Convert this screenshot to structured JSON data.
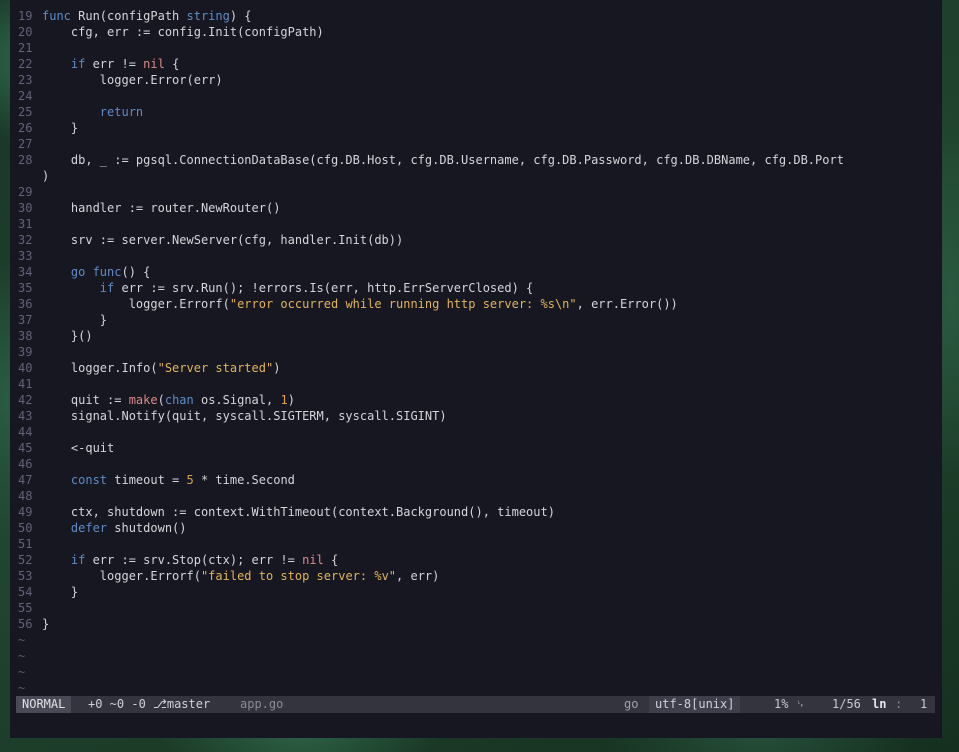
{
  "editor": {
    "lines": [
      {
        "n": "19",
        "segs": [
          [
            "kw",
            "func"
          ],
          [
            "t",
            " Run(configPath "
          ],
          [
            "kw",
            "string"
          ],
          [
            "t",
            ") {"
          ]
        ]
      },
      {
        "n": "20",
        "segs": [
          [
            "t",
            "    cfg, err := config.Init(configPath)"
          ]
        ]
      },
      {
        "n": "21",
        "segs": []
      },
      {
        "n": "22",
        "segs": [
          [
            "t",
            "    "
          ],
          [
            "kw",
            "if"
          ],
          [
            "t",
            " err != "
          ],
          [
            "bi",
            "nil"
          ],
          [
            "t",
            " {"
          ]
        ]
      },
      {
        "n": "23",
        "segs": [
          [
            "t",
            "        logger.Error(err)"
          ]
        ]
      },
      {
        "n": "24",
        "segs": []
      },
      {
        "n": "25",
        "segs": [
          [
            "t",
            "        "
          ],
          [
            "kw",
            "return"
          ]
        ]
      },
      {
        "n": "26",
        "segs": [
          [
            "t",
            "    }"
          ]
        ]
      },
      {
        "n": "27",
        "segs": []
      },
      {
        "n": "28",
        "segs": [
          [
            "t",
            "    db, _ := pgsql.ConnectionDataBase(cfg.DB.Host, cfg.DB.Username, cfg.DB.Password, cfg.DB.DBName, cfg.DB.Port"
          ]
        ]
      },
      {
        "n": "",
        "segs": [
          [
            "t",
            ")"
          ]
        ]
      },
      {
        "n": "29",
        "segs": []
      },
      {
        "n": "30",
        "segs": [
          [
            "t",
            "    handler := router.NewRouter()"
          ]
        ]
      },
      {
        "n": "31",
        "segs": []
      },
      {
        "n": "32",
        "segs": [
          [
            "t",
            "    srv := server.NewServer(cfg, handler.Init(db))"
          ]
        ]
      },
      {
        "n": "33",
        "segs": []
      },
      {
        "n": "34",
        "segs": [
          [
            "t",
            "    "
          ],
          [
            "kw",
            "go func"
          ],
          [
            "t",
            "() {"
          ]
        ]
      },
      {
        "n": "35",
        "segs": [
          [
            "t",
            "        "
          ],
          [
            "kw",
            "if"
          ],
          [
            "t",
            " err := srv.Run(); !errors.Is(err, http.ErrServerClosed) {"
          ]
        ]
      },
      {
        "n": "36",
        "segs": [
          [
            "t",
            "            logger.Errorf("
          ],
          [
            "str",
            "\"error occurred while running http server: %s\\n\""
          ],
          [
            "t",
            ", err.Error())"
          ]
        ]
      },
      {
        "n": "37",
        "segs": [
          [
            "t",
            "        }"
          ]
        ]
      },
      {
        "n": "38",
        "segs": [
          [
            "t",
            "    }()"
          ]
        ]
      },
      {
        "n": "39",
        "segs": []
      },
      {
        "n": "40",
        "segs": [
          [
            "t",
            "    logger.Info("
          ],
          [
            "str",
            "\"Server started\""
          ],
          [
            "t",
            ")"
          ]
        ]
      },
      {
        "n": "41",
        "segs": []
      },
      {
        "n": "42",
        "segs": [
          [
            "t",
            "    quit := "
          ],
          [
            "bi",
            "make"
          ],
          [
            "t",
            "("
          ],
          [
            "kw",
            "chan"
          ],
          [
            "t",
            " os.Signal, "
          ],
          [
            "num",
            "1"
          ],
          [
            "t",
            ")"
          ]
        ]
      },
      {
        "n": "43",
        "segs": [
          [
            "t",
            "    signal.Notify(quit, syscall.SIGTERM, syscall.SIGINT)"
          ]
        ]
      },
      {
        "n": "44",
        "segs": []
      },
      {
        "n": "45",
        "segs": [
          [
            "t",
            "    <-quit"
          ]
        ]
      },
      {
        "n": "46",
        "segs": []
      },
      {
        "n": "47",
        "segs": [
          [
            "t",
            "    "
          ],
          [
            "kw",
            "const"
          ],
          [
            "t",
            " timeout = "
          ],
          [
            "num",
            "5"
          ],
          [
            "t",
            " * time.Second"
          ]
        ]
      },
      {
        "n": "48",
        "segs": []
      },
      {
        "n": "49",
        "segs": [
          [
            "t",
            "    ctx, shutdown := context.WithTimeout(context.Background(), timeout)"
          ]
        ]
      },
      {
        "n": "50",
        "segs": [
          [
            "t",
            "    "
          ],
          [
            "kw",
            "defer"
          ],
          [
            "t",
            " shutdown()"
          ]
        ]
      },
      {
        "n": "51",
        "segs": []
      },
      {
        "n": "52",
        "segs": [
          [
            "t",
            "    "
          ],
          [
            "kw",
            "if"
          ],
          [
            "t",
            " err := srv.Stop(ctx); err != "
          ],
          [
            "bi",
            "nil"
          ],
          [
            "t",
            " {"
          ]
        ]
      },
      {
        "n": "53",
        "segs": [
          [
            "t",
            "        logger.Errorf("
          ],
          [
            "str",
            "\"failed to stop server: %v\""
          ],
          [
            "t",
            ", err)"
          ]
        ]
      },
      {
        "n": "54",
        "segs": [
          [
            "t",
            "    }"
          ]
        ]
      },
      {
        "n": "55",
        "segs": []
      },
      {
        "n": "56",
        "segs": [
          [
            "t",
            "}"
          ]
        ]
      }
    ],
    "tildes": [
      "~",
      "~",
      "~",
      "~"
    ]
  },
  "statusline": {
    "mode": "NORMAL",
    "git": "+0 ~0 -0 ⎇master",
    "filename": "app.go",
    "filetype": "go",
    "encoding": "utf-8[unix]",
    "percent": "1% ␊",
    "position": "1/56",
    "ln_label": "ln",
    "separator": ":",
    "column": "1"
  },
  "colors": {
    "editor_bg": "#171722",
    "keyword": "#5e8cc4",
    "string": "#e0b35c",
    "number": "#e0a050",
    "builtin": "#d98a8a",
    "line_number": "#626278",
    "statusline_bg": "#34343f"
  }
}
